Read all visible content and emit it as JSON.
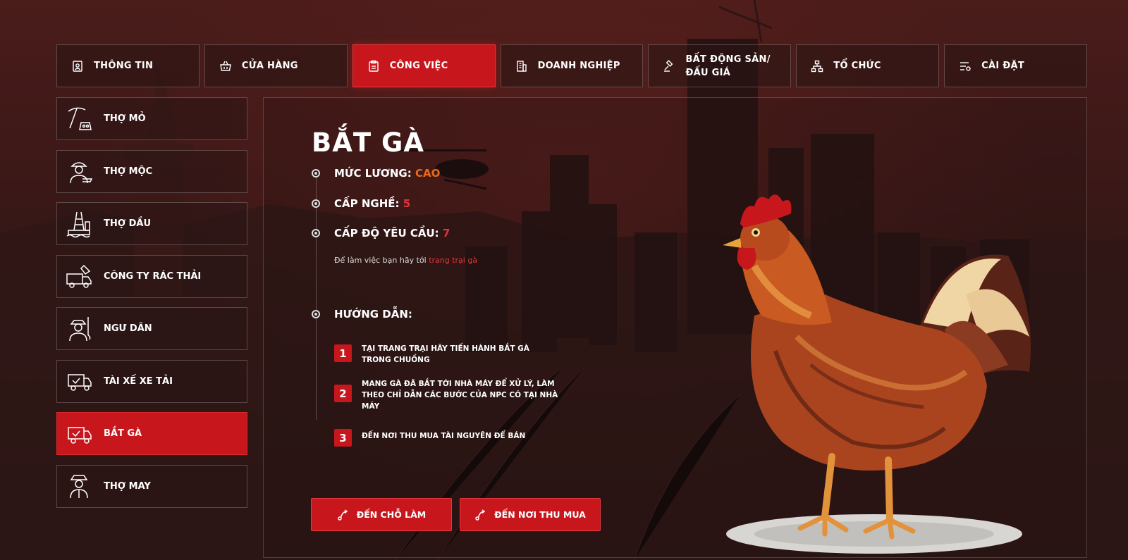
{
  "tabs": [
    {
      "label": "THÔNG TIN",
      "icon": "person-card-icon",
      "active": false
    },
    {
      "label": "CỬA HÀNG",
      "icon": "basket-icon",
      "active": false
    },
    {
      "label": "CÔNG VIỆC",
      "icon": "clipboard-icon",
      "active": true
    },
    {
      "label": "DOANH NGHIỆP",
      "icon": "building-icon",
      "active": false
    },
    {
      "label": "BẤT ĐỘNG SẢN/ ĐẤU GIÁ",
      "icon": "gavel-icon",
      "active": false
    },
    {
      "label": "TỔ CHỨC",
      "icon": "org-chart-icon",
      "active": false
    },
    {
      "label": "CÀI ĐẶT",
      "icon": "settings-sliders-icon",
      "active": false
    }
  ],
  "sidebar": {
    "items": [
      {
        "label": "THỢ MỎ",
        "icon": "pickaxe-icon",
        "active": false
      },
      {
        "label": "THỢ MỘC",
        "icon": "carpenter-icon",
        "active": false
      },
      {
        "label": "THỢ DẦU",
        "icon": "oil-rig-icon",
        "active": false
      },
      {
        "label": "CÔNG TY RÁC THẢI",
        "icon": "garbage-truck-icon",
        "active": false
      },
      {
        "label": "NGƯ DÂN",
        "icon": "fisherman-icon",
        "active": false
      },
      {
        "label": "TÀI XẾ XE TẢI",
        "icon": "delivery-truck-icon",
        "active": false
      },
      {
        "label": "BẮT GÀ",
        "icon": "delivery-truck-check-icon",
        "active": true
      },
      {
        "label": "THỢ MAY",
        "icon": "tailor-icon",
        "active": false
      }
    ]
  },
  "job": {
    "title": "BẮT GÀ",
    "salary_label": "MỨC LƯƠNG:",
    "salary_value": "CAO",
    "level_label": "CẤP NGHỀ:",
    "level_value": "5",
    "required_label": "CẤP ĐỘ YÊU CẦU:",
    "required_value": "7",
    "hint_prefix": "Để làm việc bạn hãy tới",
    "hint_link": "trang trại gà",
    "guide_label": "HƯỚNG DẪN:",
    "steps": [
      {
        "num": "1",
        "text": "TẠI TRANG TRẠI HÃY TIẾN HÀNH BẮT GÀ TRONG CHUỒNG"
      },
      {
        "num": "2",
        "text": "MANG GÀ ĐÃ BẮT TỚI NHÀ MÁY ĐỂ XỬ LÝ, LÀM THEO CHỈ DẪN CÁC BƯỚC CỦA NPC CÓ TẠI NHÀ MÁY"
      },
      {
        "num": "3",
        "text": "ĐẾN NƠI THU MUA TÀI NGUYÊN ĐỂ BÁN"
      }
    ]
  },
  "buttons": {
    "go_work": "ĐẾN CHỖ LÀM",
    "go_buy": "ĐẾN NƠI THU MUA"
  },
  "colors": {
    "accent": "#c8161d",
    "salary": "#e86a1e",
    "highlight": "#e0343b"
  }
}
